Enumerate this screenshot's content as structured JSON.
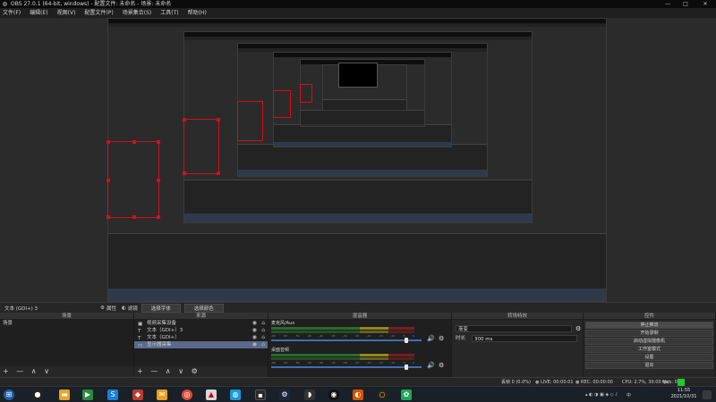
{
  "window": {
    "title": "OBS 27.0.1 (64-bit, windows) - 配置文件: 未命名 - 场景: 未命名",
    "controls": [
      "—",
      "□",
      "✕"
    ]
  },
  "menu": [
    "文件(F)",
    "编辑(E)",
    "视图(V)",
    "配置文件(P)",
    "场景集合(S)",
    "工具(T)",
    "帮助(H)"
  ],
  "source_toolbar": {
    "selected_source": "文本 (GDI+) 3",
    "properties_label": "属性",
    "filters_label": "滤镜",
    "select_font_label": "选择字体",
    "select_color_label": "选择颜色"
  },
  "scenes": {
    "header": "场景",
    "items": [
      "场景"
    ]
  },
  "sources": {
    "header": "来源",
    "items": [
      {
        "name": "视频采集设备",
        "icon": "camera-icon"
      },
      {
        "name": "文本（GDI+）3",
        "icon": "text-icon"
      },
      {
        "name": "文本（GDI+）",
        "icon": "text-icon"
      },
      {
        "name": "显示器采集",
        "icon": "monitor-icon",
        "selected": true
      }
    ]
  },
  "mixer": {
    "header": "混音器",
    "channels": [
      {
        "name": "麦克风/Aux",
        "level": 0.9
      },
      {
        "name": "桌面音频",
        "level": 0.9
      }
    ],
    "ticks": [
      "-60",
      "-55",
      "-50",
      "-45",
      "-40",
      "-35",
      "-30",
      "-25",
      "-20",
      "-15",
      "-10",
      "-5",
      "0"
    ]
  },
  "transitions": {
    "header": "转场特效",
    "type": "渐变",
    "duration_label": "时长",
    "duration_value": "300 ms"
  },
  "controls": {
    "header": "控件",
    "buttons": [
      "停止推流",
      "开始录制",
      "启动虚拟摄像机",
      "工作室模式",
      "设置",
      "退出"
    ]
  },
  "dock_footer_glyphs": "+ — ∧ ∨",
  "status": {
    "dropped_frames": "丢帧 0 (0.0%)",
    "live": "LIVE: 00:00:01",
    "rec": "REC: 00:00:00",
    "cpu": "CPU: 2.7%, 30.00 fps",
    "kbps": "kb/s: 0"
  },
  "taskbar": {
    "clock_time": "11:55",
    "clock_date": "2021/10/31",
    "tray_lang": "中"
  },
  "colors": {
    "accent_blue": "#3c6fb5",
    "live_green": "#1fcc2b",
    "selection_red": "#d0101a"
  }
}
